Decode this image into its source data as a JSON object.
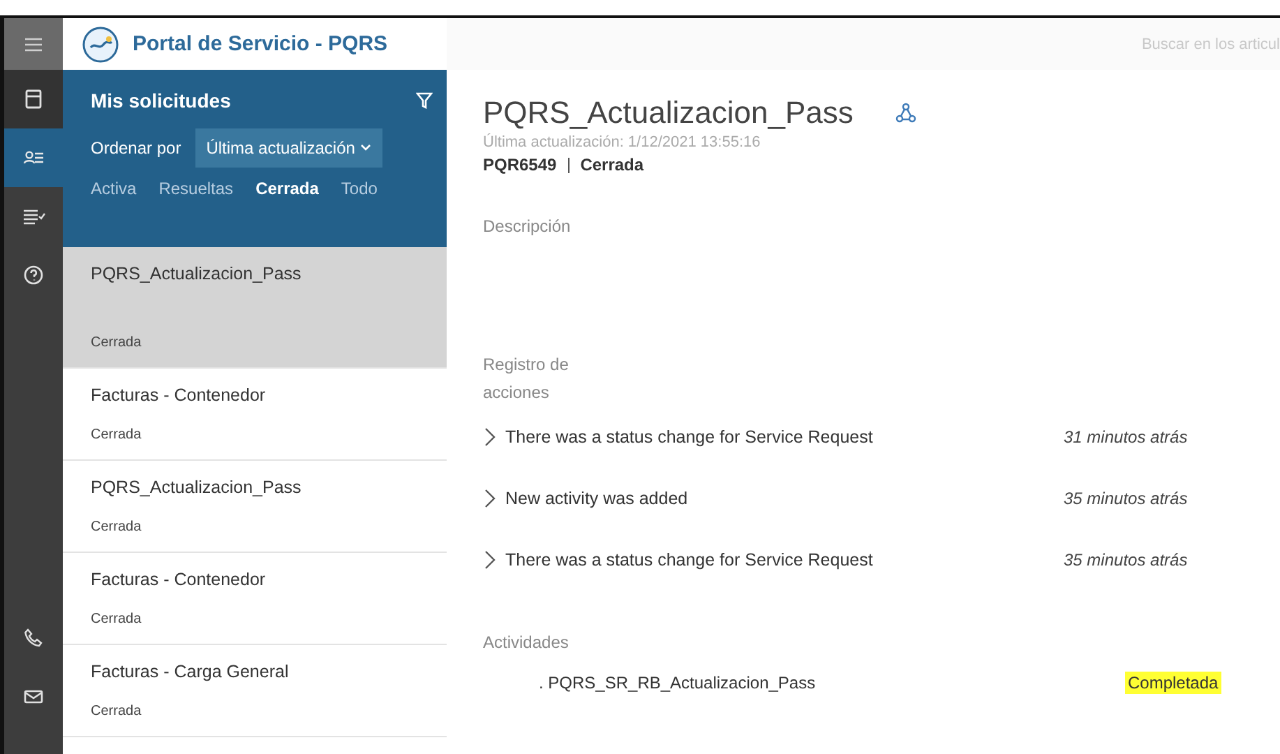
{
  "rail_items": [
    {
      "kind": "menu",
      "selected": false
    },
    {
      "kind": "document",
      "selected": false
    },
    {
      "kind": "requests",
      "selected": true
    },
    {
      "kind": "list",
      "selected": false
    },
    {
      "kind": "help",
      "selected": false
    },
    {
      "kind": "phone",
      "selected": false
    },
    {
      "kind": "mail",
      "selected": false
    }
  ],
  "header": {
    "title": "Portal de Servicio - PQRS",
    "search": {
      "placeholder": "Buscar en los articul"
    }
  },
  "list_panel": {
    "title": "Mis solicitudes",
    "sort_label": "Ordenar por",
    "sort_value": "Última actualización",
    "tabs": [
      {
        "label": "Activa",
        "selected": false
      },
      {
        "label": "Resueltas",
        "selected": false
      },
      {
        "label": "Cerrada",
        "selected": true
      },
      {
        "label": "Todo",
        "selected": false
      }
    ],
    "items": [
      {
        "title": "PQRS_Actualizacion_Pass",
        "status": "Cerrada",
        "selected": true
      },
      {
        "title": "Facturas - Contenedor",
        "status": "Cerrada",
        "selected": false
      },
      {
        "title": "PQRS_Actualizacion_Pass",
        "status": "Cerrada",
        "selected": false
      },
      {
        "title": "Facturas - Contenedor",
        "status": "Cerrada",
        "selected": false
      },
      {
        "title": "Facturas - Carga General",
        "status": "Cerrada",
        "selected": false
      }
    ]
  },
  "detail": {
    "title": "PQRS_Actualizacion_Pass",
    "updated": "Última actualización: 1/12/2021 13:55:16",
    "number": "PQR6549",
    "status": "Cerrada",
    "description_label": "Descripción",
    "log_label": "Registro de acciones",
    "log": [
      {
        "text": "There was a status change for Service Request",
        "time": "31 minutos atrás"
      },
      {
        "text": "New activity was added",
        "time": "35 minutos atrás"
      },
      {
        "text": "There was a status change for Service Request",
        "time": "35 minutos atrás"
      }
    ],
    "activities_label": "Actividades",
    "activities": [
      {
        "name": ". PQRS_SR_RB_Actualizacion_Pass",
        "status": "Completada",
        "highlighted": true
      }
    ]
  }
}
